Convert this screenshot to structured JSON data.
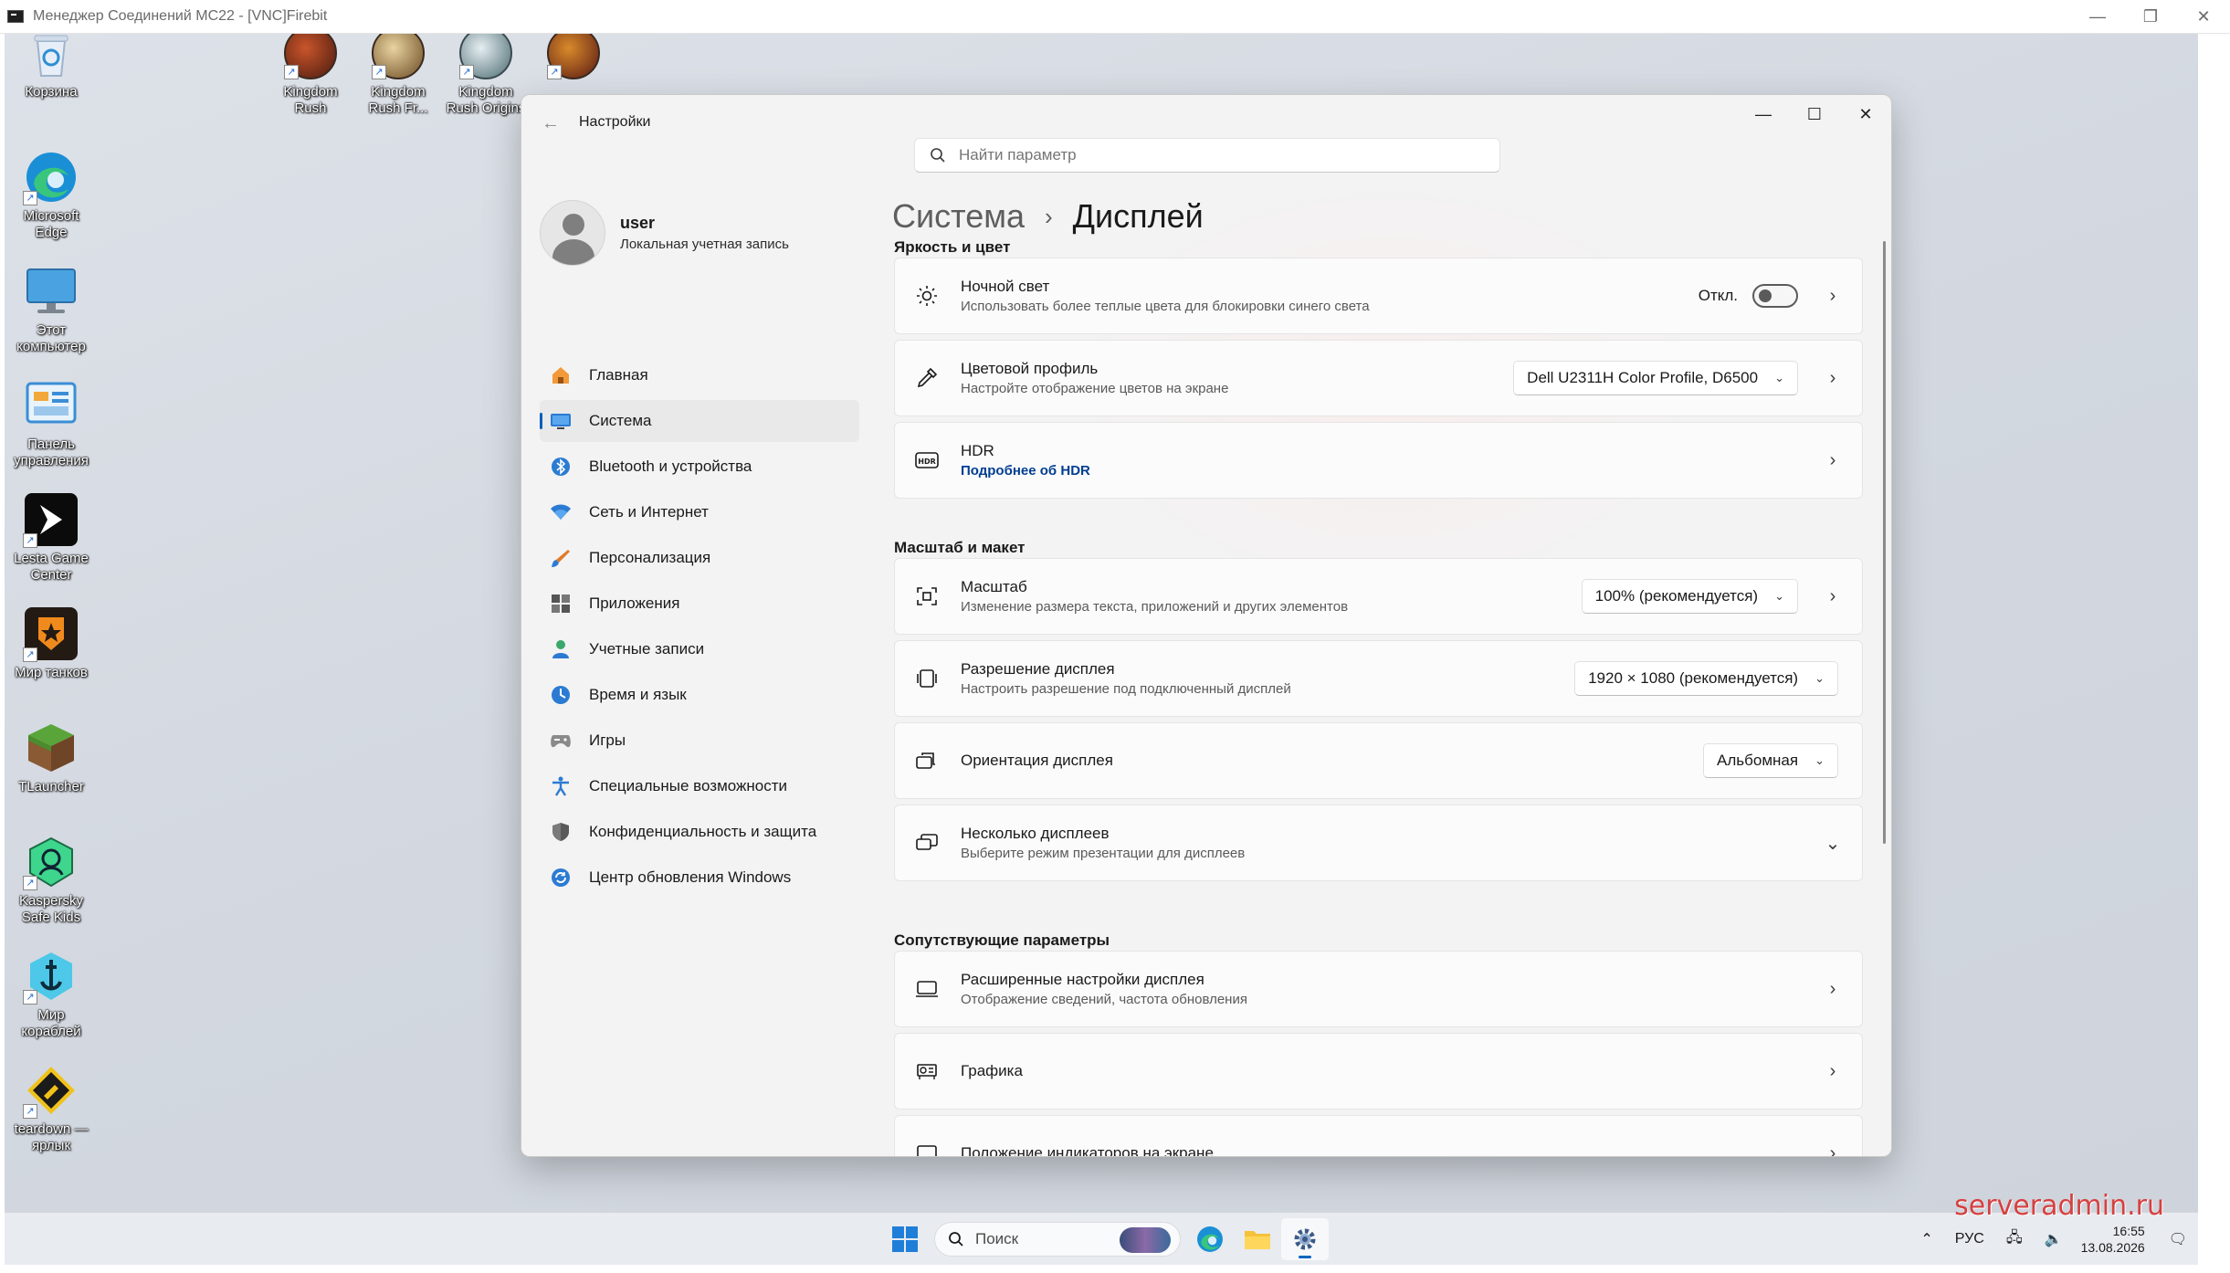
{
  "outer": {
    "title": "Менеджер Соединений MC22 - [VNC]Firebit",
    "controls": [
      "—",
      "❐",
      "✕"
    ]
  },
  "desktop": {
    "icons": [
      {
        "label": "Корзина",
        "icon": "recycle-bin-icon"
      },
      {
        "label": "Microsoft\nEdge",
        "icon": "edge-icon"
      },
      {
        "label": "Этот\nкомпьютер",
        "icon": "computer-icon"
      },
      {
        "label": "Панель\nуправления",
        "icon": "control-panel-icon"
      },
      {
        "label": "Lesta Game\nCenter",
        "icon": "lesta-icon"
      },
      {
        "label": "Мир танков",
        "icon": "tanks-icon"
      },
      {
        "label": "TLauncher",
        "icon": "tlauncher-icon"
      },
      {
        "label": "Kaspersky\nSafe Kids",
        "icon": "kaspersky-icon"
      },
      {
        "label": "Мир\nкораблей",
        "icon": "ships-icon"
      },
      {
        "label": "teardown —\nярлык",
        "icon": "teardown-icon"
      },
      {
        "label": "Kingdom\nRush",
        "icon": "kingdom-rush-icon"
      },
      {
        "label": "Kingdom\nRush Fr...",
        "icon": "kingdom-rush-frontiers-icon"
      },
      {
        "label": "Kingdom\nRush Origins",
        "icon": "kingdom-rush-origins-icon"
      },
      {
        "label": "",
        "icon": "kingdom-rush-vengeance-icon"
      }
    ]
  },
  "settings": {
    "window_title": "Настройки",
    "search_placeholder": "Найти параметр",
    "user": {
      "name": "user",
      "type": "Локальная учетная запись"
    },
    "nav": [
      {
        "label": "Главная",
        "icon": "home-icon"
      },
      {
        "label": "Система",
        "icon": "system-icon",
        "active": true
      },
      {
        "label": "Bluetooth и устройства",
        "icon": "bluetooth-icon"
      },
      {
        "label": "Сеть и Интернет",
        "icon": "wifi-icon"
      },
      {
        "label": "Персонализация",
        "icon": "brush-icon"
      },
      {
        "label": "Приложения",
        "icon": "apps-icon"
      },
      {
        "label": "Учетные записи",
        "icon": "accounts-icon"
      },
      {
        "label": "Время и язык",
        "icon": "time-language-icon"
      },
      {
        "label": "Игры",
        "icon": "gamepad-icon"
      },
      {
        "label": "Специальные возможности",
        "icon": "accessibility-icon"
      },
      {
        "label": "Конфиденциальность и защита",
        "icon": "shield-icon"
      },
      {
        "label": "Центр обновления Windows",
        "icon": "update-icon"
      }
    ],
    "breadcrumb": {
      "parent": "Система",
      "separator": "›",
      "current": "Дисплей"
    },
    "sections": {
      "brightness": "Яркость и цвет",
      "scale": "Масштаб и макет",
      "related": "Сопутствующие параметры"
    },
    "cards": {
      "night_light": {
        "title": "Ночной свет",
        "sub": "Использовать более теплые цвета для блокировки синего света",
        "state": "Откл."
      },
      "color_profile": {
        "title": "Цветовой профиль",
        "sub": "Настройте отображение цветов на экране",
        "value": "Dell U2311H Color Profile, D6500"
      },
      "hdr": {
        "title": "HDR",
        "sub": "Подробнее об HDR"
      },
      "scale": {
        "title": "Масштаб",
        "sub": "Изменение размера текста, приложений и других элементов",
        "value": "100% (рекомендуется)"
      },
      "resolution": {
        "title": "Разрешение дисплея",
        "sub": "Настроить разрешение под подключенный дисплей",
        "value": "1920 × 1080 (рекомендуется)"
      },
      "orientation": {
        "title": "Ориентация дисплея",
        "value": "Альбомная"
      },
      "multiple": {
        "title": "Несколько дисплеев",
        "sub": "Выберите режим презентации для дисплеев"
      },
      "advanced": {
        "title": "Расширенные настройки дисплея",
        "sub": "Отображение сведений, частота обновления"
      },
      "graphics": {
        "title": "Графика"
      },
      "indicators": {
        "title": "Положение индикаторов на экране"
      }
    }
  },
  "taskbar": {
    "search_label": "Поиск",
    "lang": "РУС",
    "time": "16:55",
    "date": "13.08.2026"
  },
  "watermark": "serveradmin.ru",
  "colors": {
    "accent": "#005fb8",
    "link": "#003e92",
    "window_bg": "#f3f3f3",
    "card_bg": "#fbfbfb"
  }
}
